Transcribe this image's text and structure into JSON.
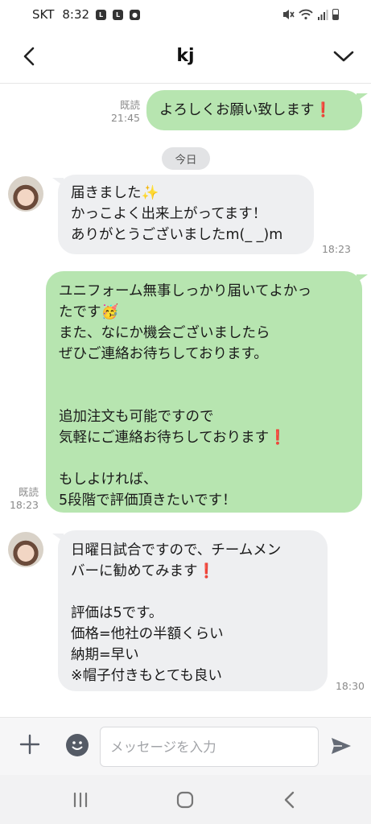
{
  "status_bar": {
    "carrier": "SKT",
    "time": "8:32",
    "notification_icons": [
      "line-icon",
      "line-icon",
      "camera-icon"
    ],
    "system_icons": [
      "mute-icon",
      "wifi-icon",
      "signal-icon",
      "battery-icon"
    ]
  },
  "header": {
    "title": "kj"
  },
  "chat": {
    "date_separator": "今日",
    "messages": [
      {
        "direction": "out",
        "text": "よろしくお願い致します",
        "emoji": "❗",
        "read": "既読",
        "time": "21:45"
      },
      {
        "direction": "in",
        "line1": "届きました",
        "emoji1": "✨",
        "line2": "かっこよく出来上がってます！",
        "line3": "ありがとうございましたm(_ _)m",
        "time": "18:23"
      },
      {
        "direction": "out",
        "line1": "ユニフォーム無事しっかり届いてよかっ",
        "line2": "たです",
        "emoji1": "🥳",
        "line3": "また、なにか機会ございましたら",
        "line4": "ぜひご連絡お待ちしております。",
        "line5": "追加注文も可能ですので",
        "line6": "気軽にご連絡お待ちしております",
        "emoji2": "❗",
        "line7": "もしよければ、",
        "line8": "5段階で評価頂きたいです！",
        "read": "既読",
        "time": "18:23"
      },
      {
        "direction": "in",
        "line1": "日曜日試合ですので、チームメン",
        "line2": "バーに勧めてみます",
        "emoji1": "❗",
        "line3": "評価は5です。",
        "line4": "価格=他社の半額くらい",
        "line5": "納期=早い",
        "line6": "※帽子付きもとても良い",
        "time": "18:30"
      }
    ]
  },
  "input": {
    "placeholder": "メッセージを入力",
    "value": ""
  },
  "colors": {
    "outgoing_bubble": "#b7e5b0",
    "incoming_bubble": "#eeeff1",
    "accent_red": "#e0262d"
  }
}
